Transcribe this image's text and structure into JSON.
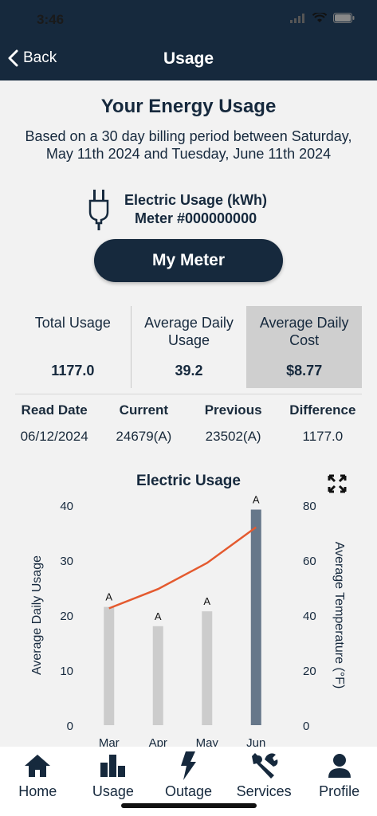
{
  "status_bar": {
    "time": "3:46"
  },
  "nav": {
    "back_label": "Back",
    "title": "Usage"
  },
  "usage": {
    "heading": "Your Energy Usage",
    "period_text": "Based on a 30 day billing period between Saturday, May 11th 2024 and Tuesday, June 11th 2024",
    "meter_type": "Electric Usage (kWh)",
    "meter_number": "Meter #000000000",
    "my_meter_button": "My Meter"
  },
  "stats": [
    {
      "label": "Total Usage",
      "value": "1177.0"
    },
    {
      "label": "Average Daily Usage",
      "value": "39.2"
    },
    {
      "label": "Average Daily Cost",
      "value": "$8.77"
    }
  ],
  "readings": {
    "headers": [
      "Read Date",
      "Current",
      "Previous",
      "Difference"
    ],
    "values": [
      "06/12/2024",
      "24679(A)",
      "23502(A)",
      "1177.0"
    ]
  },
  "chart_data": {
    "type": "bar",
    "title": "Electric Usage",
    "categories": [
      "Mar",
      "Apr",
      "May",
      "Jun"
    ],
    "series": [
      {
        "values": [
          21.5,
          18,
          20.7,
          39.2
        ],
        "labels": [
          "A",
          "A",
          "A",
          "A"
        ],
        "color": "#cccccc",
        "highlight_color": "#66778a"
      },
      {
        "values": [
          42.5,
          49.5,
          59,
          72
        ],
        "color": "#e45a2f",
        "type": "line",
        "axis": "right"
      }
    ],
    "ylabel": "Average Daily Usage",
    "y2label": "Average Temperature (°F)",
    "ylim": [
      0,
      40
    ],
    "y2lim": [
      0,
      80
    ],
    "yticks": [
      0,
      10,
      20,
      30,
      40
    ],
    "y2ticks": [
      0,
      20,
      40,
      60,
      80
    ],
    "highlight_index": 3
  },
  "tabs": [
    {
      "label": "Home",
      "icon": "home-icon"
    },
    {
      "label": "Usage",
      "icon": "bar-chart-icon"
    },
    {
      "label": "Outage",
      "icon": "lightning-icon"
    },
    {
      "label": "Services",
      "icon": "wrench-icon"
    },
    {
      "label": "Profile",
      "icon": "person-icon"
    }
  ]
}
